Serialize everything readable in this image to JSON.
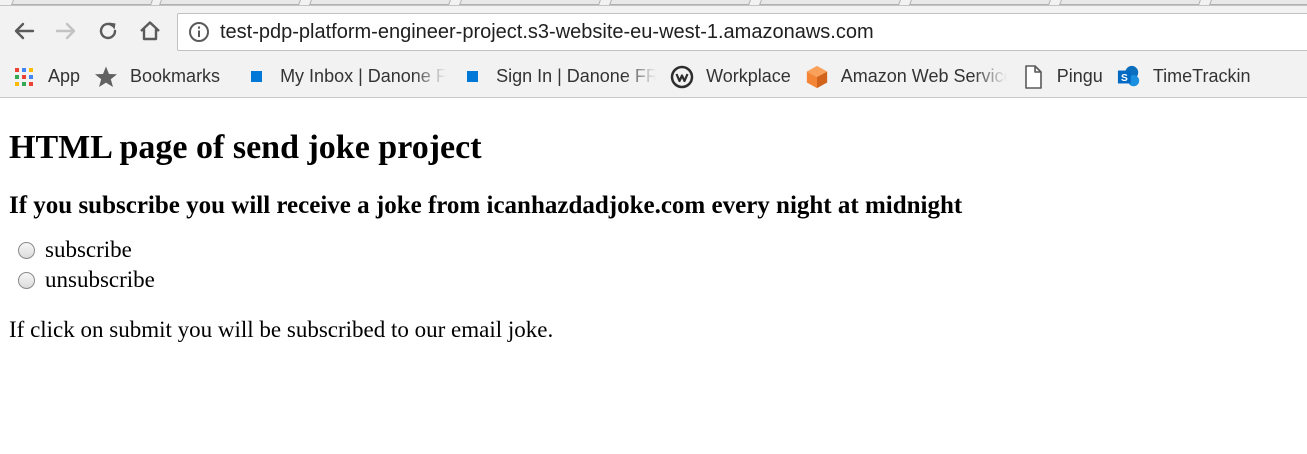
{
  "browser": {
    "address_bar": {
      "url": "test-pdp-platform-engineer-project.s3-website-eu-west-1.amazonaws.com"
    },
    "bookmarks": [
      {
        "label": "App",
        "icon": "apps-grid-icon"
      },
      {
        "label": "Bookmarks",
        "icon": "star-icon"
      },
      {
        "label": "My Inbox | Danone F",
        "icon": "blue-square-icon",
        "color": "#0078d7"
      },
      {
        "label": "Sign In | Danone FR",
        "icon": "blue-square-icon",
        "color": "#0078d7"
      },
      {
        "label": "Workplace",
        "icon": "workplace-icon"
      },
      {
        "label": "Amazon Web Service",
        "icon": "aws-cube-icon",
        "color": "#f58536"
      },
      {
        "label": "Pingu",
        "icon": "page-icon"
      },
      {
        "label": "TimeTrackin",
        "icon": "sharepoint-icon",
        "color": "#0078d7"
      }
    ]
  },
  "page": {
    "title": "HTML page of send joke project",
    "subtitle": "If you subscribe you will receive a joke from icanhazdadjoke.com every night at midnight",
    "options": [
      {
        "label": "subscribe",
        "checked": false
      },
      {
        "label": "unsubscribe",
        "checked": false
      }
    ],
    "note": "If click on submit you will be subscribed to our email joke."
  }
}
